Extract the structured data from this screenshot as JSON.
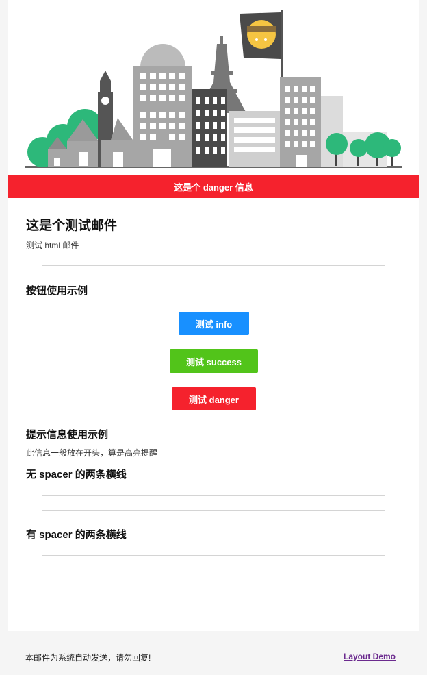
{
  "alert": {
    "text": "这是个 danger 信息",
    "color": "#f5222d"
  },
  "mail": {
    "title": "这是个测试邮件",
    "subtitle": "测试 html 邮件"
  },
  "buttons_section": {
    "heading": "按钮使用示例",
    "info_label": "测试 info",
    "success_label": "测试 success",
    "danger_label": "测试 danger"
  },
  "tips_section": {
    "heading": "提示信息使用示例",
    "text": "此信息一般放在开头，算是高亮提醒"
  },
  "lines_no_spacer": {
    "heading": "无 spacer 的两条横线"
  },
  "lines_with_spacer": {
    "heading": "有 spacer 的两条横线"
  },
  "footer": {
    "text": "本邮件为系统自动发送，请勿回复!",
    "link": "Layout Demo"
  },
  "colors": {
    "info": "#1890ff",
    "success": "#52c41a",
    "danger": "#f5222d",
    "link": "#6b2a8e"
  }
}
